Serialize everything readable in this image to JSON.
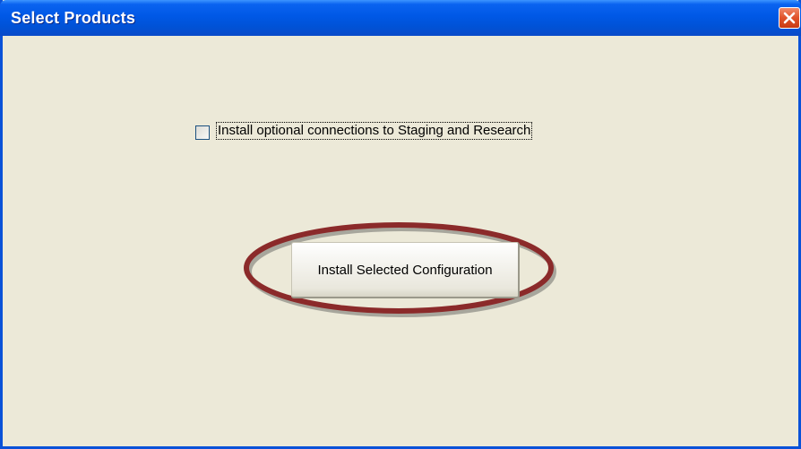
{
  "window": {
    "title": "Select Products",
    "close_icon": "close-x-icon"
  },
  "options": {
    "checkbox_label": "Install optional connections to Staging and Research",
    "checkbox_checked": false
  },
  "actions": {
    "install_button_label": "Install Selected Configuration"
  },
  "annotation": {
    "highlight_color": "#8b2a2a"
  },
  "colors": {
    "titlebar": "#0058e6",
    "window_bg": "#ece9d8",
    "close_button": "#e0522a"
  }
}
